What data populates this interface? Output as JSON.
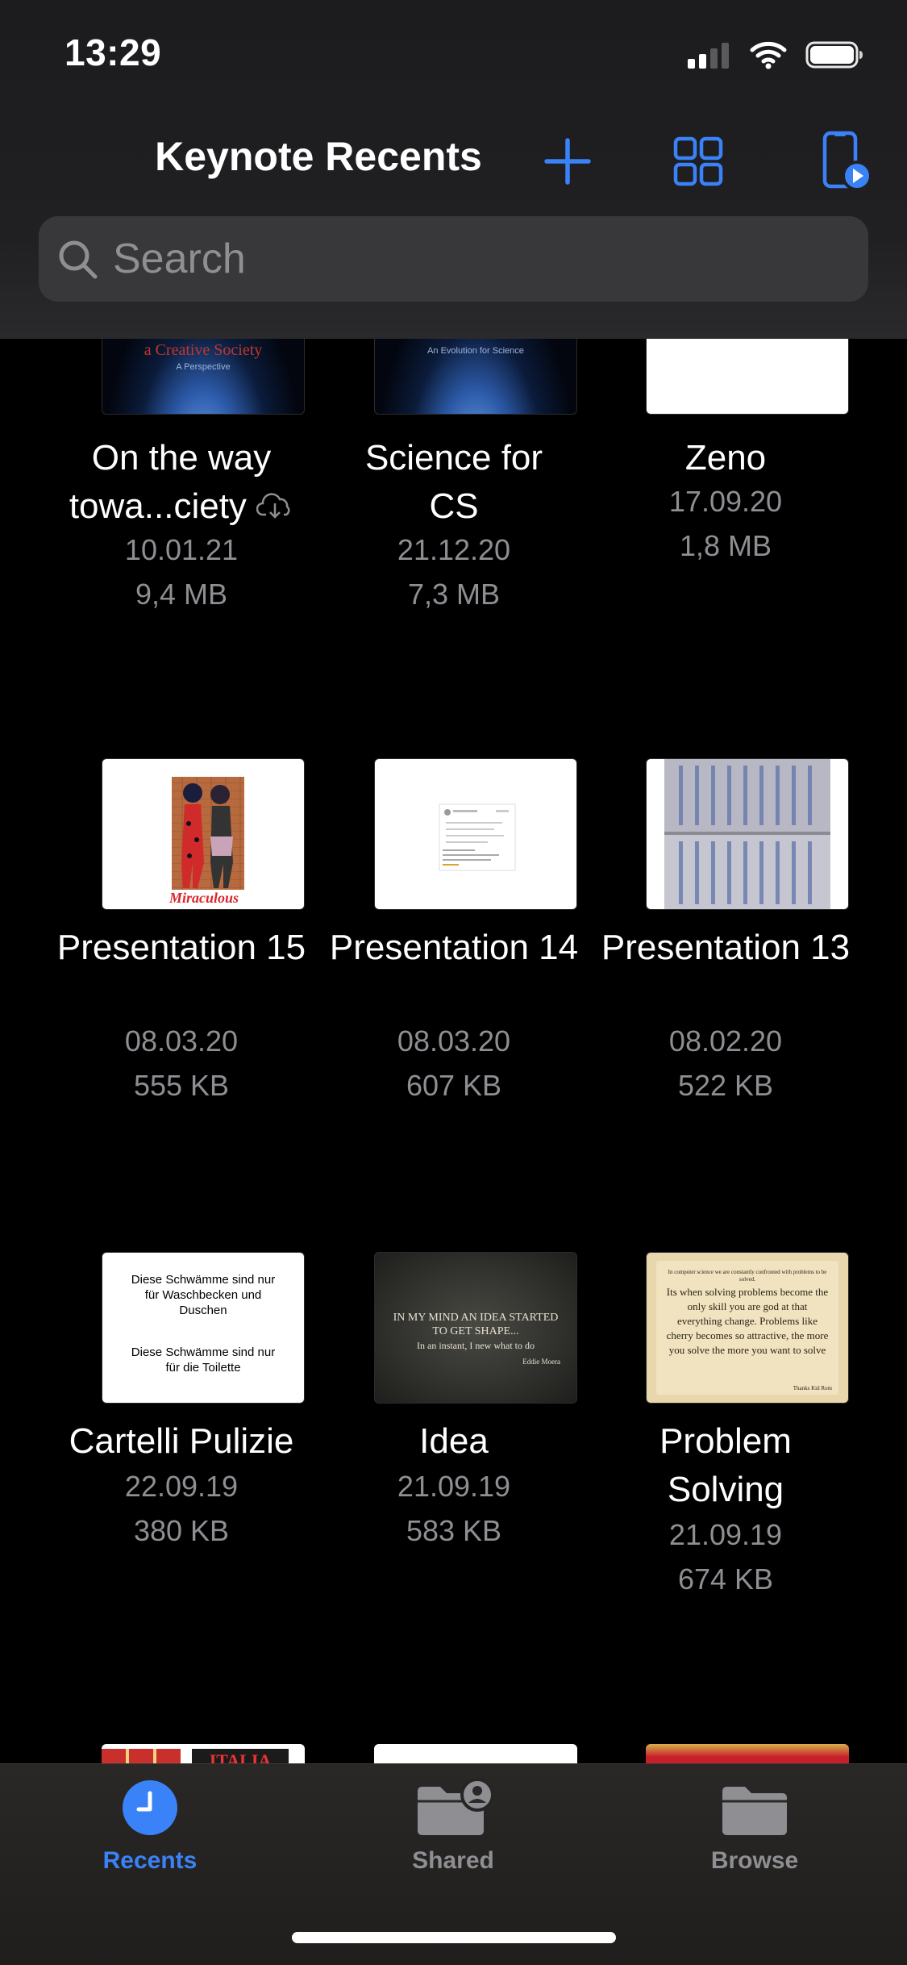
{
  "status": {
    "time": "13:29"
  },
  "nav": {
    "title": "Keynote Recents"
  },
  "search": {
    "placeholder": "Search"
  },
  "docs": [
    {
      "title": "On the way towa...ciety",
      "date": "10.01.21",
      "size": "9,4 MB",
      "thumb_text": "a Creative Society",
      "thumb_sub": "A Perspective"
    },
    {
      "title": "Science for CS",
      "date": "21.12.20",
      "size": "7,3 MB",
      "thumb_sub": "An Evolution for Science"
    },
    {
      "title": "Zeno",
      "date": "17.09.20",
      "size": "1,8 MB"
    },
    {
      "title": "Presentation 15",
      "date": "08.03.20",
      "size": "555 KB",
      "thumb_text": "Miraculous"
    },
    {
      "title": "Presentation 14",
      "date": "08.03.20",
      "size": "607 KB"
    },
    {
      "title": "Presentation 13",
      "date": "08.02.20",
      "size": "522 KB"
    },
    {
      "title": "Cartelli Pulizie",
      "date": "22.09.19",
      "size": "380 KB",
      "thumb_line1": "Diese Schwämme sind nur für Waschbecken und Duschen",
      "thumb_line2": "Diese Schwämme sind nur für die Toilette"
    },
    {
      "title": "Idea",
      "date": "21.09.19",
      "size": "583 KB",
      "thumb_line1": "IN MY MIND AN IDEA STARTED TO GET SHAPE...",
      "thumb_line2": "In an instant, I new what to do",
      "thumb_author": "Eddie Moera"
    },
    {
      "title": "Problem Solving",
      "date": "21.09.19",
      "size": "674 KB",
      "thumb_small": "In computer science we are constantly confronted with problems to be solved.",
      "thumb_body": "Its when solving problems become the only skill you are god at that everything change. Problems like cherry becomes so attractive, the more you solve the more you want to solve",
      "thumb_author": "Thanks Kid Rom"
    }
  ],
  "partial_row": {
    "thumb_text": "ITALIA"
  },
  "tabs": [
    {
      "label": "Recents",
      "active": true
    },
    {
      "label": "Shared",
      "active": false
    },
    {
      "label": "Browse",
      "active": false
    }
  ],
  "colors": {
    "accent": "#3a82f7",
    "inactive": "#8e8e93",
    "background": "#000000"
  }
}
